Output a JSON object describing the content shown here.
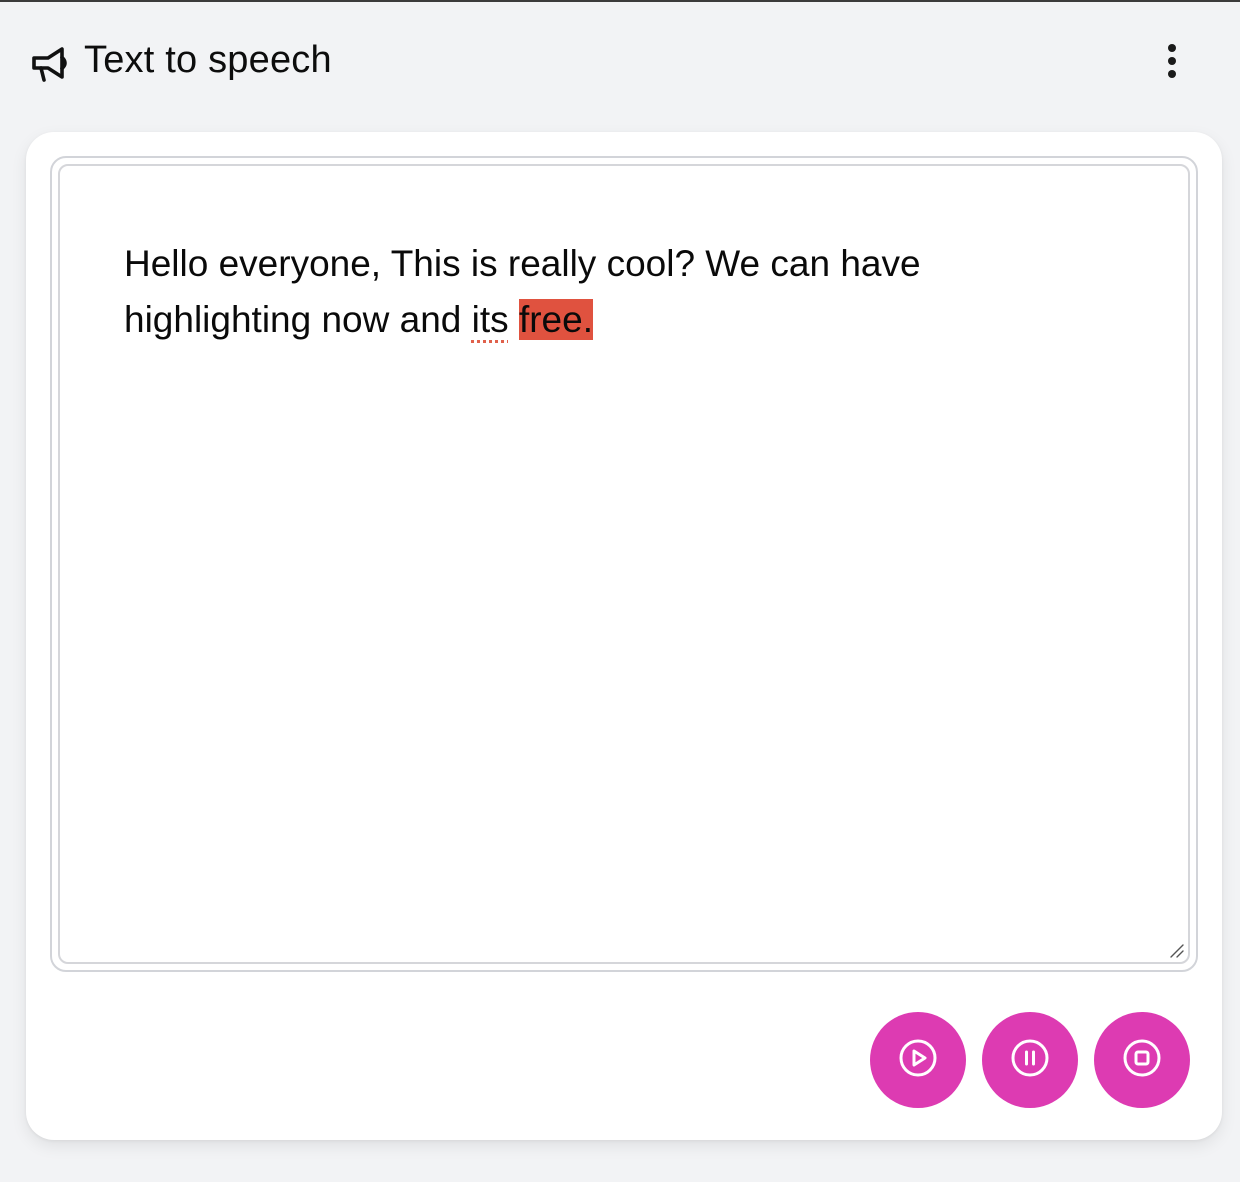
{
  "header": {
    "title": "Text to speech",
    "icon": "megaphone-icon",
    "menu_icon": "more-vertical-icon"
  },
  "editor": {
    "segments": [
      {
        "text": "Hello everyone, This is really cool? We can have highlighting now and ",
        "style": "normal"
      },
      {
        "text": "its",
        "style": "spellcheck"
      },
      {
        "text": " ",
        "style": "normal"
      },
      {
        "text": "free.",
        "style": "highlight"
      }
    ],
    "highlight_color": "#e0523f",
    "spellcheck_color": "#e0614b"
  },
  "controls": {
    "accent_color": "#dd3bb2",
    "buttons": [
      {
        "name": "play",
        "icon": "play-circle-icon"
      },
      {
        "name": "pause",
        "icon": "pause-circle-icon"
      },
      {
        "name": "stop",
        "icon": "stop-circle-icon"
      }
    ]
  }
}
